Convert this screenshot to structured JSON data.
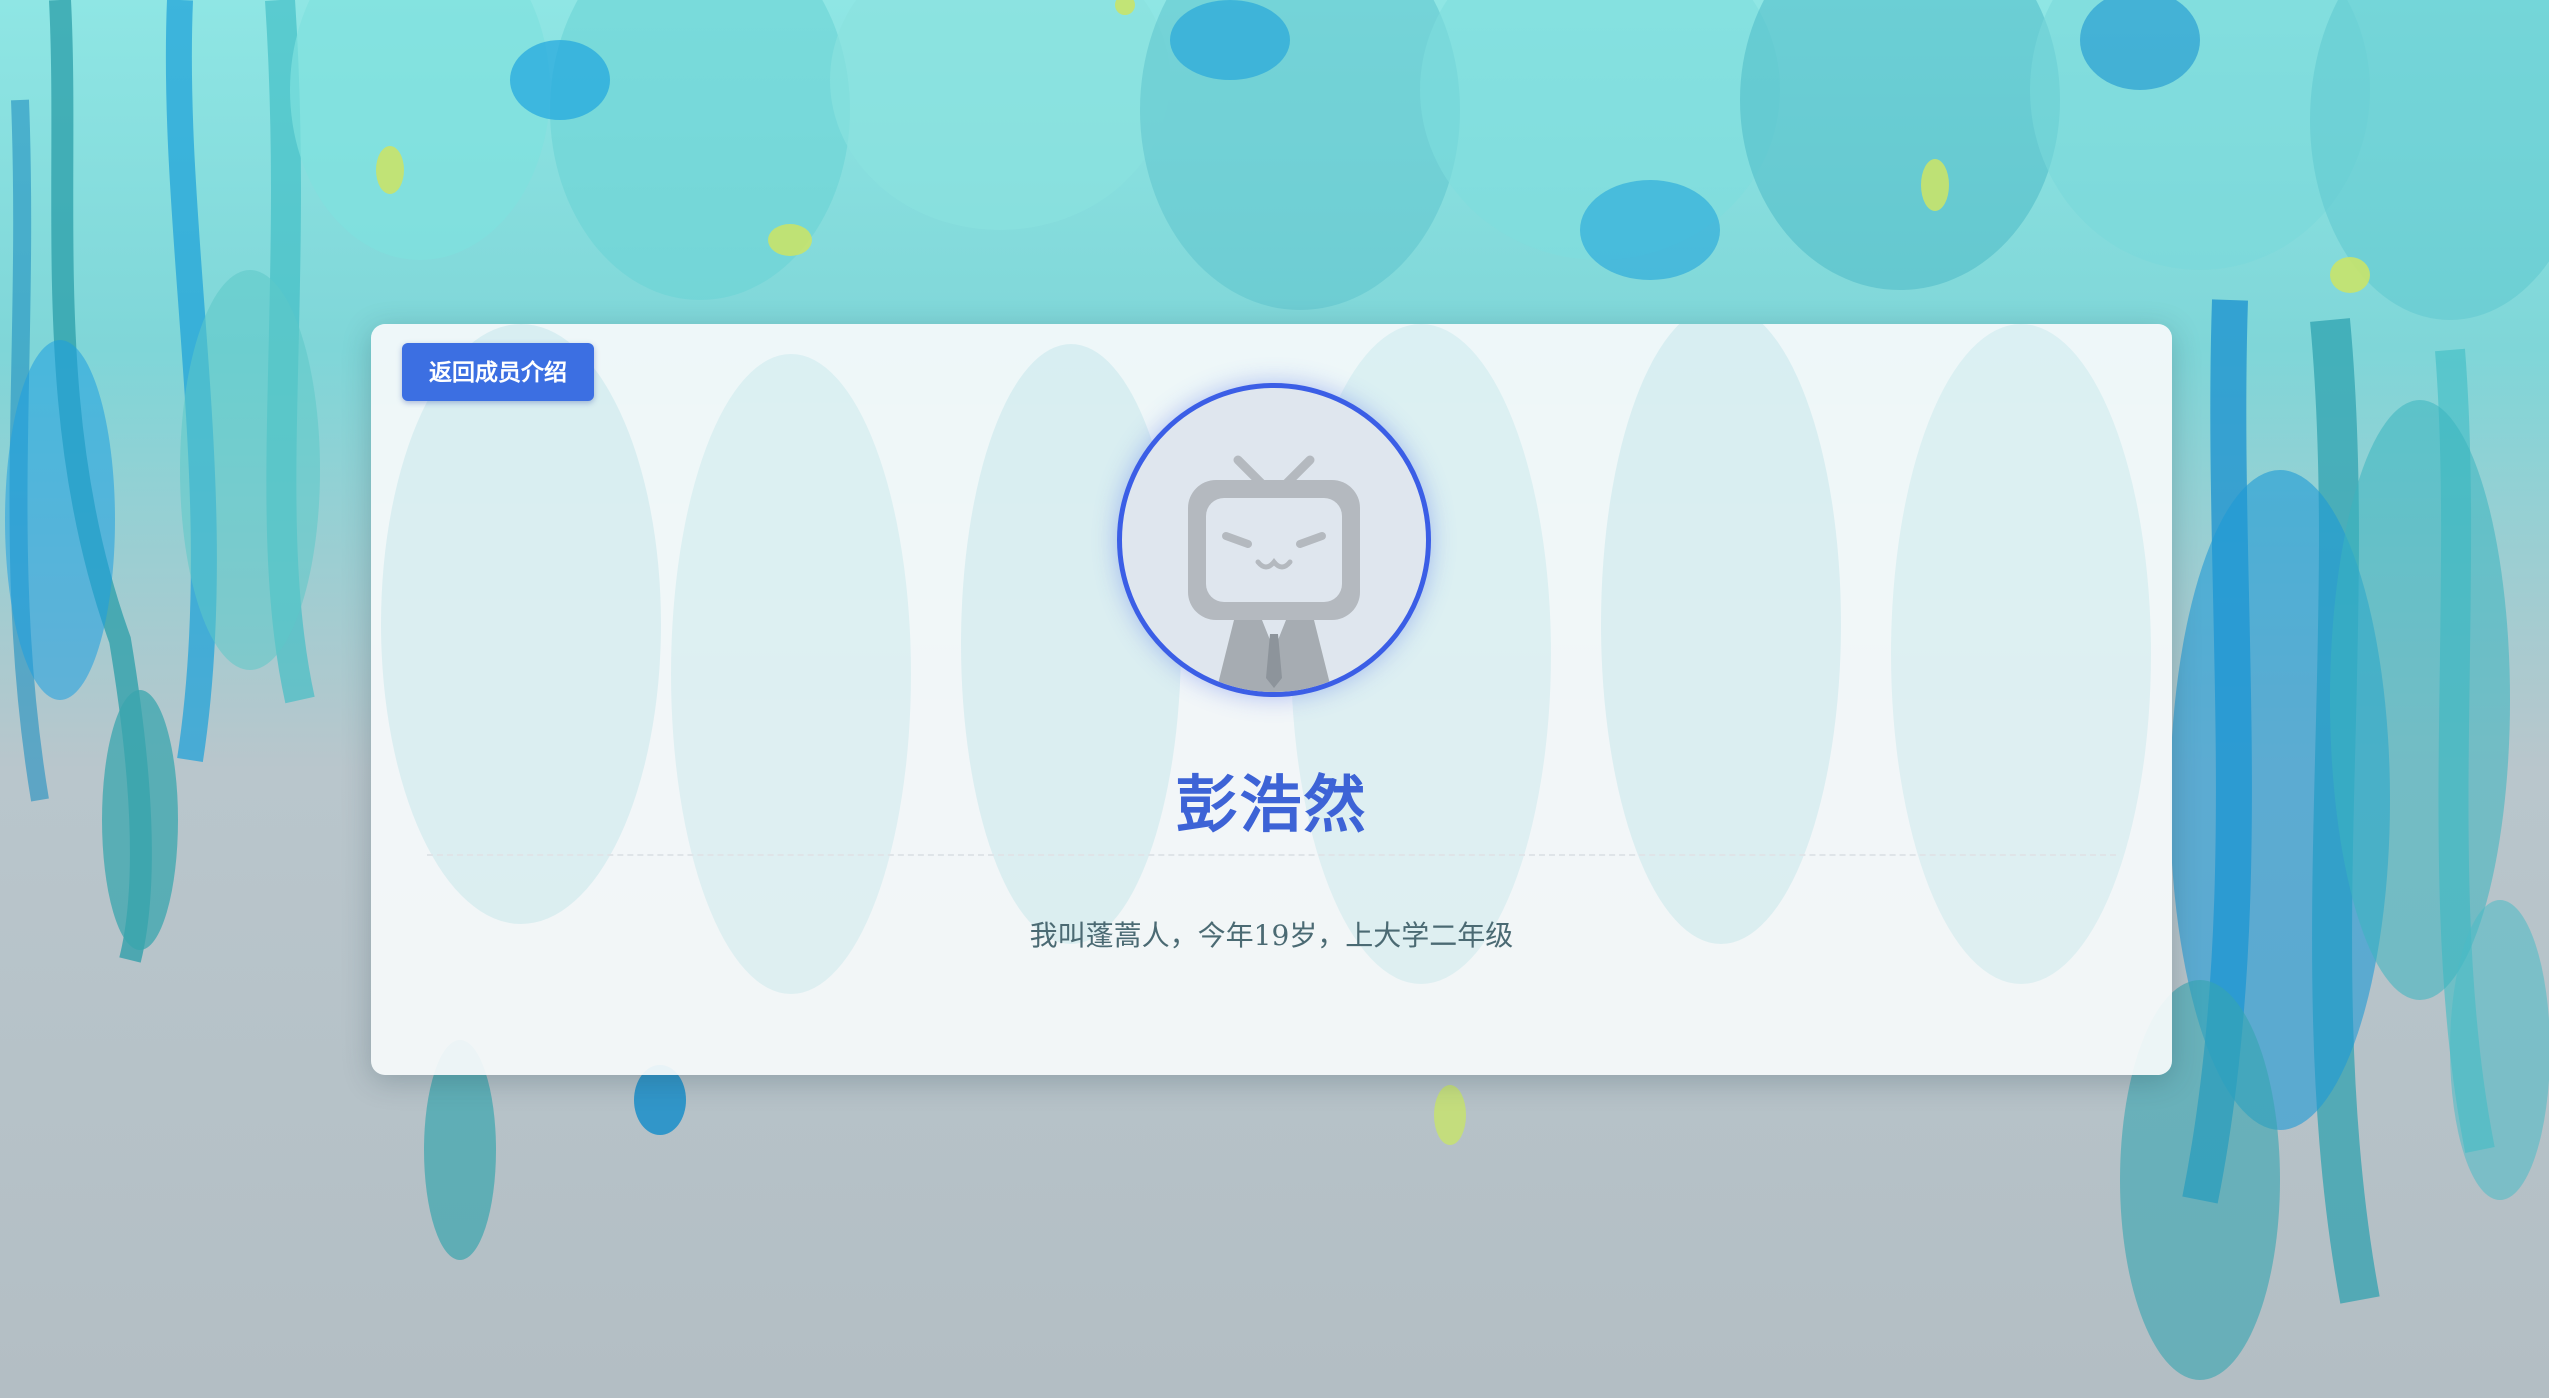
{
  "page": {
    "back_button_label": "返回成员介绍"
  },
  "member": {
    "name": "彭浩然",
    "bio": "我叫蓬蒿人，今年19岁，上大学二年级"
  },
  "avatar": {
    "icon": "bilibili-tv-mascot-icon"
  },
  "colors": {
    "accent": "#3c6fe2",
    "name_text": "#3d63d6",
    "avatar_border": "#3b5ee6",
    "bio_text": "#4b6a73",
    "background_top": "#8fe6e4",
    "background_bottom": "#b3bec4"
  }
}
